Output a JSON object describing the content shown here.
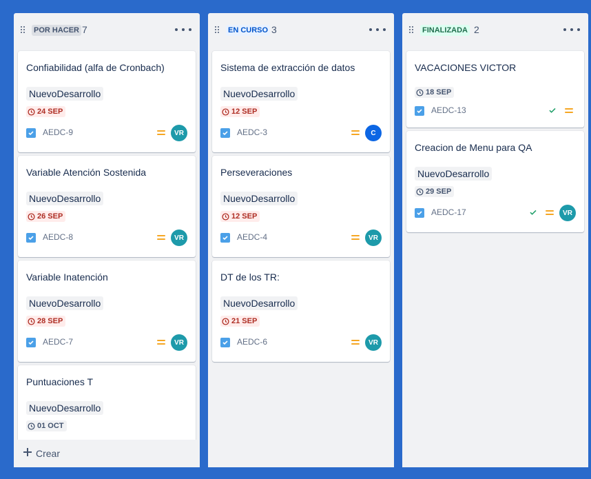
{
  "colors": {
    "board_background": "#2a6acb",
    "column_background": "#f1f2f4",
    "todo_lozenge_bg": "#dcdfe4",
    "todo_lozenge_fg": "#44546f",
    "inprogress_lozenge_bg": "#e9f2ff",
    "inprogress_lozenge_fg": "#0055cc",
    "done_lozenge_bg": "#dcfff1",
    "done_lozenge_fg": "#216e4e",
    "avatar_vr": "#1d9aaa",
    "avatar_c": "#0c66e4",
    "priority_medium": "#f5a623"
  },
  "columns": [
    {
      "status": "POR HACER",
      "count": "7",
      "create_label": "Crear",
      "cards": [
        {
          "title": "Confiabilidad (alfa de Cronbach)",
          "label": "NuevoDesarrollo",
          "due": "24 SEP",
          "due_state": "overdue",
          "key": "AEDC-9",
          "avatar": "VR",
          "done": false
        },
        {
          "title": "Variable Atención Sostenida",
          "label": "NuevoDesarrollo",
          "due": "26 SEP",
          "due_state": "overdue",
          "key": "AEDC-8",
          "avatar": "VR",
          "done": false
        },
        {
          "title": "Variable Inatención",
          "label": "NuevoDesarrollo",
          "due": "28 SEP",
          "due_state": "overdue",
          "key": "AEDC-7",
          "avatar": "VR",
          "done": false
        },
        {
          "title": "Puntuaciones T",
          "label": "NuevoDesarrollo",
          "due": "01 OCT",
          "due_state": "normal",
          "key": "",
          "avatar": "",
          "done": false
        }
      ]
    },
    {
      "status": "EN CURSO",
      "count": "3",
      "cards": [
        {
          "title": "Sistema de extracción de datos",
          "label": "NuevoDesarrollo",
          "due": "12 SEP",
          "due_state": "overdue",
          "key": "AEDC-3",
          "avatar": "C",
          "done": false
        },
        {
          "title": "Perseveraciones",
          "label": "NuevoDesarrollo",
          "due": "12 SEP",
          "due_state": "overdue",
          "key": "AEDC-4",
          "avatar": "VR",
          "done": false
        },
        {
          "title": "DT de los TR:",
          "label": "NuevoDesarrollo",
          "due": "21 SEP",
          "due_state": "overdue",
          "key": "AEDC-6",
          "avatar": "VR",
          "done": false
        }
      ]
    },
    {
      "status": "FINALIZADA",
      "count": "2",
      "cards": [
        {
          "title": "VACACIONES VICTOR",
          "label": "",
          "due": "18 SEP",
          "due_state": "normal",
          "key": "AEDC-13",
          "avatar": "",
          "done": true
        },
        {
          "title": "Creacion de Menu para QA",
          "label": "NuevoDesarrollo",
          "due": "29 SEP",
          "due_state": "normal",
          "key": "AEDC-17",
          "avatar": "VR",
          "done": true
        }
      ]
    }
  ]
}
